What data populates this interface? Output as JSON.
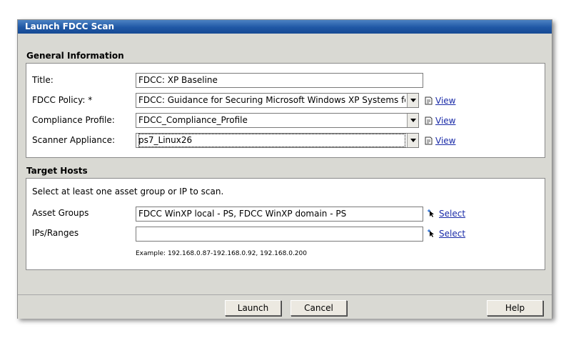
{
  "dialog": {
    "title": "Launch FDCC Scan"
  },
  "general": {
    "heading": "General Information",
    "title_label": "Title:",
    "title_value": "FDCC: XP Baseline",
    "policy_label": "FDCC Policy: *",
    "policy_value": "FDCC: Guidance for Securing Microsoft Windows XP Systems fo",
    "profile_label": "Compliance Profile:",
    "profile_value": "FDCC_Compliance_Profile",
    "scanner_label": "Scanner Appliance:",
    "scanner_value": "ps7_Linux26",
    "view_label": "View"
  },
  "targets": {
    "heading": "Target Hosts",
    "instruction": "Select at least one asset group or IP to scan.",
    "asset_label": "Asset Groups",
    "asset_value": "FDCC WinXP local - PS, FDCC WinXP domain - PS",
    "ips_label": "IPs/Ranges",
    "ips_value": "",
    "select_label": "Select",
    "example": "Example: 192.168.0.87-192.168.0.92, 192.168.0.200"
  },
  "buttons": {
    "launch": "Launch",
    "cancel": "Cancel",
    "help": "Help"
  },
  "icons": {
    "view": "view-icon",
    "select": "select-pointer-icon"
  }
}
